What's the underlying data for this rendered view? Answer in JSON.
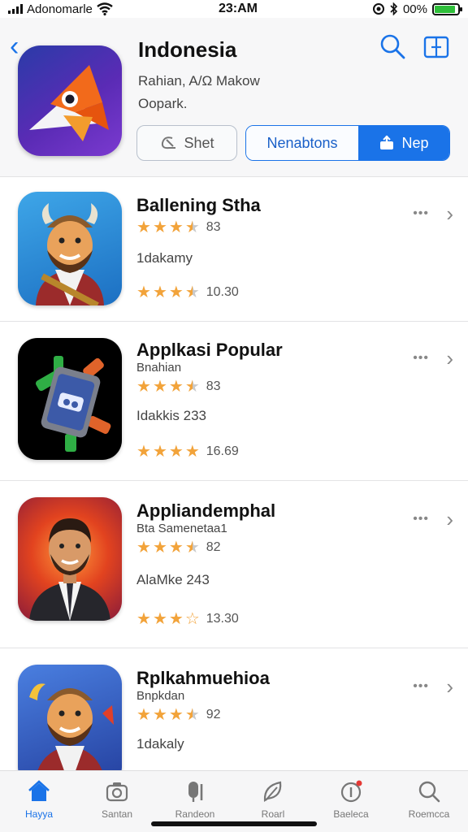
{
  "status_bar": {
    "carrier": "Adonomarle",
    "time": "23:AM",
    "battery_pct": "00%",
    "battery_level": 0.9
  },
  "header": {
    "title": "Indonesia",
    "subtitle_1": "Rahian, A/Ω Makow",
    "subtitle_2": "Oopark.",
    "buttons": {
      "outline_label": "Shet",
      "segment_left": "Nenabtons",
      "segment_right": "Nep"
    },
    "icons": [
      "back-chevron-icon",
      "search-icon",
      "share-icon"
    ]
  },
  "list": {
    "rows": [
      {
        "title": "Ballening Stha",
        "subtitle": "",
        "rating_1": "83",
        "rating_1_stars": 3.5,
        "detail": "1dakamy",
        "rating_2": "10.30",
        "rating_2_stars": 3.5
      },
      {
        "title": "Applkasi Popular",
        "subtitle": "Bnahian",
        "rating_1": "83",
        "rating_1_stars": 3.5,
        "detail": "Idakkis 233",
        "rating_2": "16.69",
        "rating_2_stars": 4
      },
      {
        "title": "Appliandemphal",
        "subtitle": "Bta Samenetaa1",
        "rating_1": "82",
        "rating_1_stars": 3.5,
        "detail": "AlaMke 243",
        "rating_2": "13.30",
        "rating_2_stars": 3
      },
      {
        "title": "Rplkahmuehioa",
        "subtitle": "Bnpkdan",
        "rating_1": "92",
        "rating_1_stars": 3.5,
        "detail": "1dakaly",
        "rating_2": "",
        "rating_2_stars": 0
      }
    ],
    "more_label": "•••"
  },
  "tabbar": {
    "tabs": [
      {
        "label": "Hayya",
        "icon": "home-icon",
        "active": true
      },
      {
        "label": "Santan",
        "icon": "camera-icon",
        "active": false
      },
      {
        "label": "Randeon",
        "icon": "mic-icon",
        "active": false
      },
      {
        "label": "Roarl",
        "icon": "leaf-icon",
        "active": false
      },
      {
        "label": "Baeleca",
        "icon": "notification-icon",
        "active": false
      },
      {
        "label": "Roemcca",
        "icon": "search-icon",
        "active": false
      }
    ]
  },
  "colors": {
    "accent": "#1a73e8",
    "star": "#f2a33a",
    "badge": "#e53935"
  }
}
